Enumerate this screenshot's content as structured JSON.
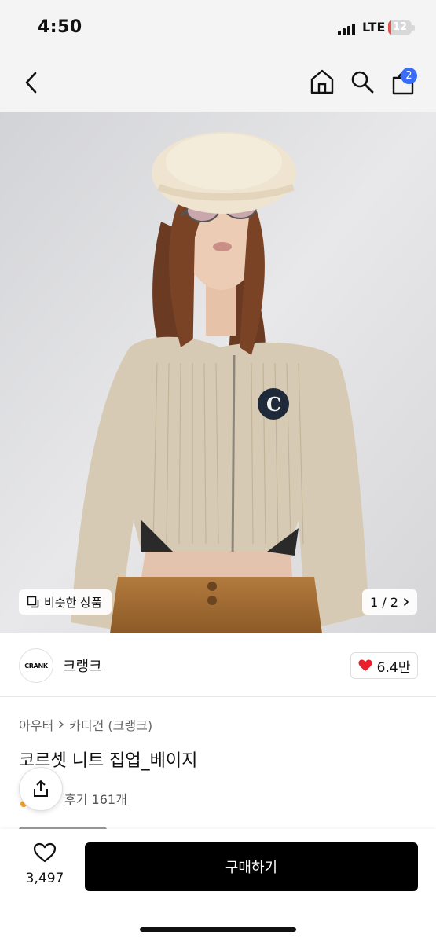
{
  "status": {
    "time": "4:50",
    "network": "LTE",
    "battery": "12",
    "battery_level": 0.12
  },
  "nav": {
    "cart_count": "2"
  },
  "hero": {
    "similar_label": "비슷한 상품",
    "page_indicator": "1 / 2"
  },
  "brand": {
    "logo_text": "CRANK",
    "name": "크랭크",
    "likes": "6.4만"
  },
  "product": {
    "breadcrumb": [
      "아우터",
      "카디건 (크랭크)"
    ],
    "title": "코르셋 니트 집업_베이지",
    "review_link": "후기 161개"
  },
  "bottom": {
    "wish_count": "3,497",
    "buy_label": "구매하기"
  },
  "colors": {
    "badge": "#3a6cf4",
    "heart": "#e8202e",
    "buy_bg": "#000000",
    "battery_low": "#e3524e"
  }
}
